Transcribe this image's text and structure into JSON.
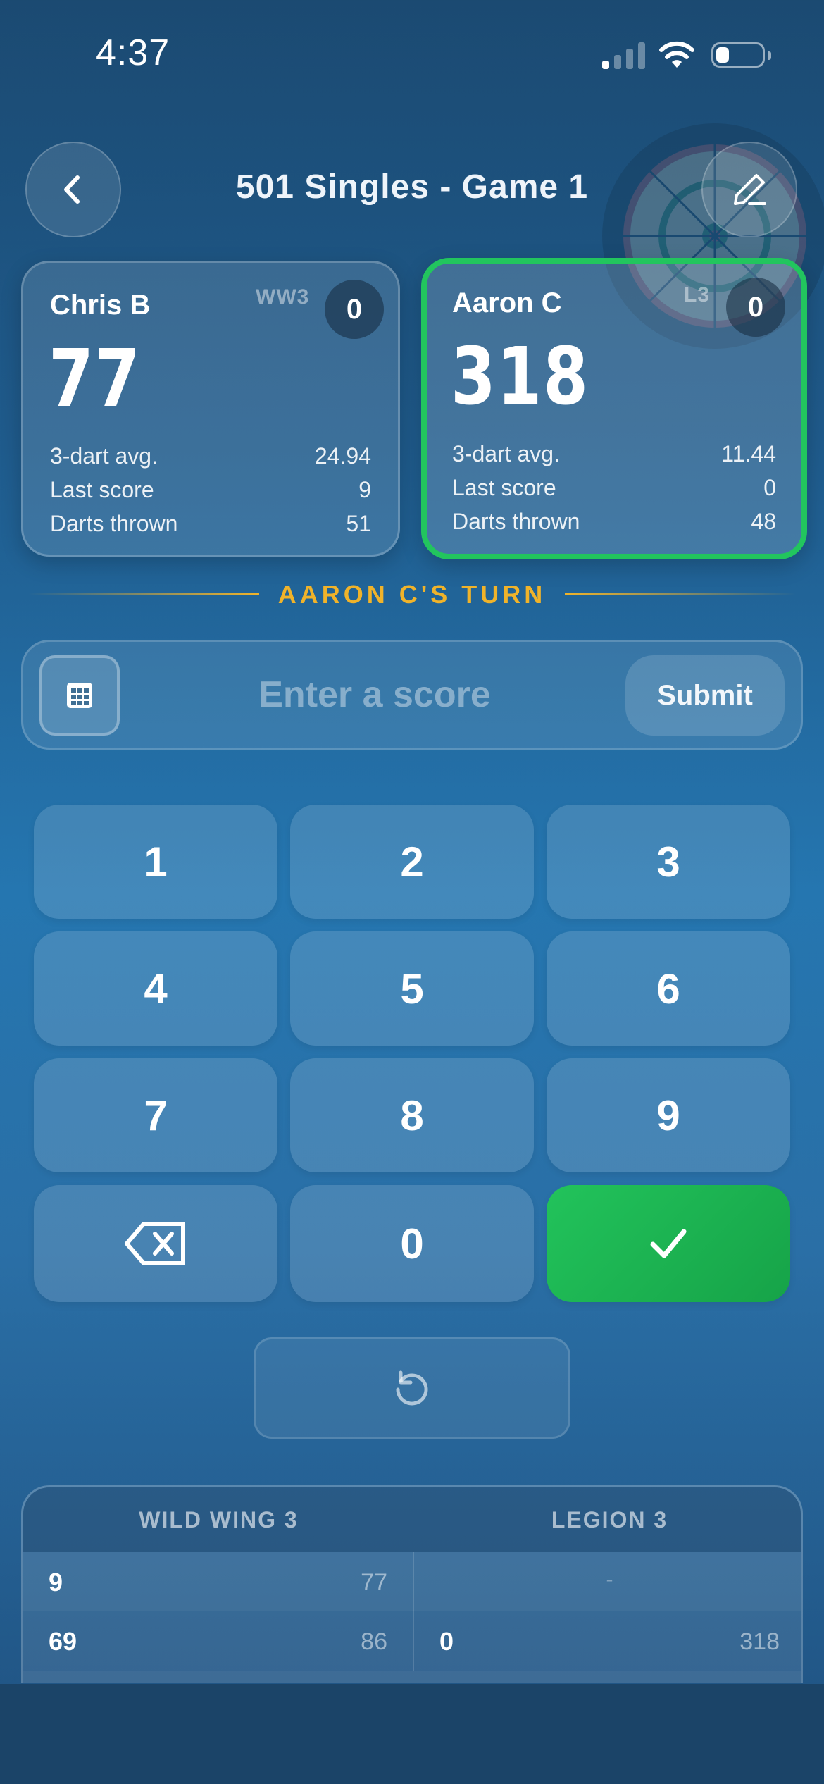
{
  "status": {
    "time": "4:37"
  },
  "header": {
    "title": "501 Singles - Game 1",
    "back_icon": "chevron-left-icon",
    "edit_icon": "pencil-icon"
  },
  "players": [
    {
      "name": "Chris B",
      "tag": "WW3",
      "legs": "0",
      "score": "77",
      "stats": [
        {
          "label": "3-dart avg.",
          "value": "24.94"
        },
        {
          "label": "Last score",
          "value": "9"
        },
        {
          "label": "Darts thrown",
          "value": "51"
        }
      ]
    },
    {
      "name": "Aaron C",
      "tag": "L3",
      "legs": "0",
      "score": "318",
      "stats": [
        {
          "label": "3-dart avg.",
          "value": "11.44"
        },
        {
          "label": "Last score",
          "value": "0"
        },
        {
          "label": "Darts thrown",
          "value": "48"
        }
      ]
    }
  ],
  "turn": {
    "label": "AARON C'S TURN",
    "color": "#f0b32a"
  },
  "input": {
    "placeholder": "Enter a score",
    "submit_label": "Submit"
  },
  "keypad": {
    "keys": [
      "1",
      "2",
      "3",
      "4",
      "5",
      "6",
      "7",
      "8",
      "9"
    ],
    "zero": "0",
    "backspace_icon": "backspace-icon",
    "confirm_icon": "checkmark-icon",
    "confirm_color": "#22c35b"
  },
  "undo_icon": "undo-icon",
  "score_table": {
    "teams": [
      "WILD WING 3",
      "LEGION 3"
    ],
    "rows": [
      {
        "left": {
          "points": "9",
          "remaining": "77"
        },
        "right": {
          "dash": "-"
        }
      },
      {
        "left": {
          "points": "69",
          "remaining": "86"
        },
        "right": {
          "points": "0",
          "remaining": "318"
        }
      }
    ]
  },
  "colors": {
    "active_border": "#22c55e",
    "background": "#2576b0"
  }
}
